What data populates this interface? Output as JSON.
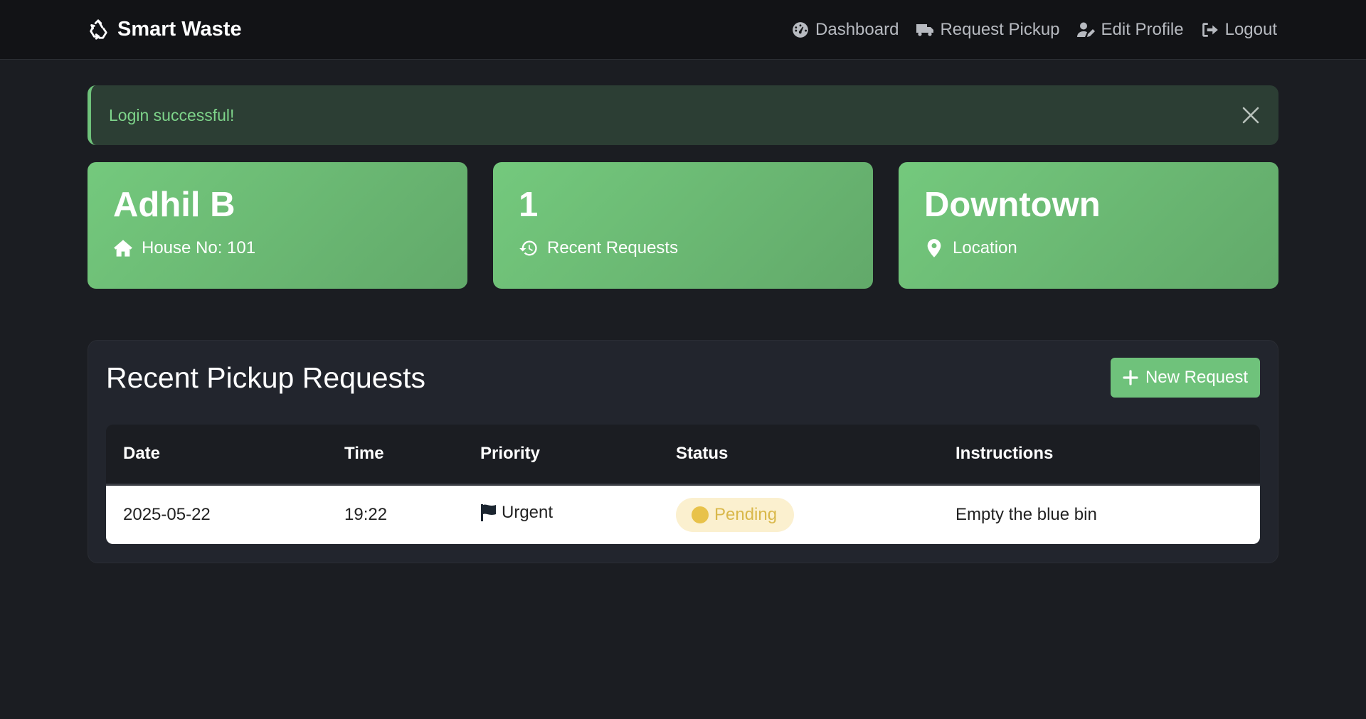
{
  "brand": {
    "name": "Smart Waste",
    "icon": "recycle-icon"
  },
  "nav": [
    {
      "label": "Dashboard",
      "icon": "dashboard-gauge-icon"
    },
    {
      "label": "Request Pickup",
      "icon": "truck-icon"
    },
    {
      "label": "Edit Profile",
      "icon": "user-edit-icon"
    },
    {
      "label": "Logout",
      "icon": "logout-icon"
    }
  ],
  "alert": {
    "message": "Login successful!"
  },
  "cards": [
    {
      "value": "Adhil B",
      "label": "House No: 101",
      "icon": "house-icon"
    },
    {
      "value": "1",
      "label": "Recent Requests",
      "icon": "history-icon"
    },
    {
      "value": "Downtown",
      "label": "Location",
      "icon": "map-pin-icon"
    }
  ],
  "panel": {
    "title": "Recent Pickup Requests",
    "new_button": "New Request"
  },
  "table": {
    "headers": [
      "Date",
      "Time",
      "Priority",
      "Status",
      "Instructions"
    ],
    "rows": [
      {
        "date": "2025-05-22",
        "time": "19:22",
        "priority": "Urgent",
        "status": "Pending",
        "instructions": "Empty the blue bin"
      }
    ]
  },
  "colors": {
    "accent": "#6fc27b",
    "background": "#1b1d22",
    "navbar": "#121316",
    "pending": "#e8c24a"
  }
}
